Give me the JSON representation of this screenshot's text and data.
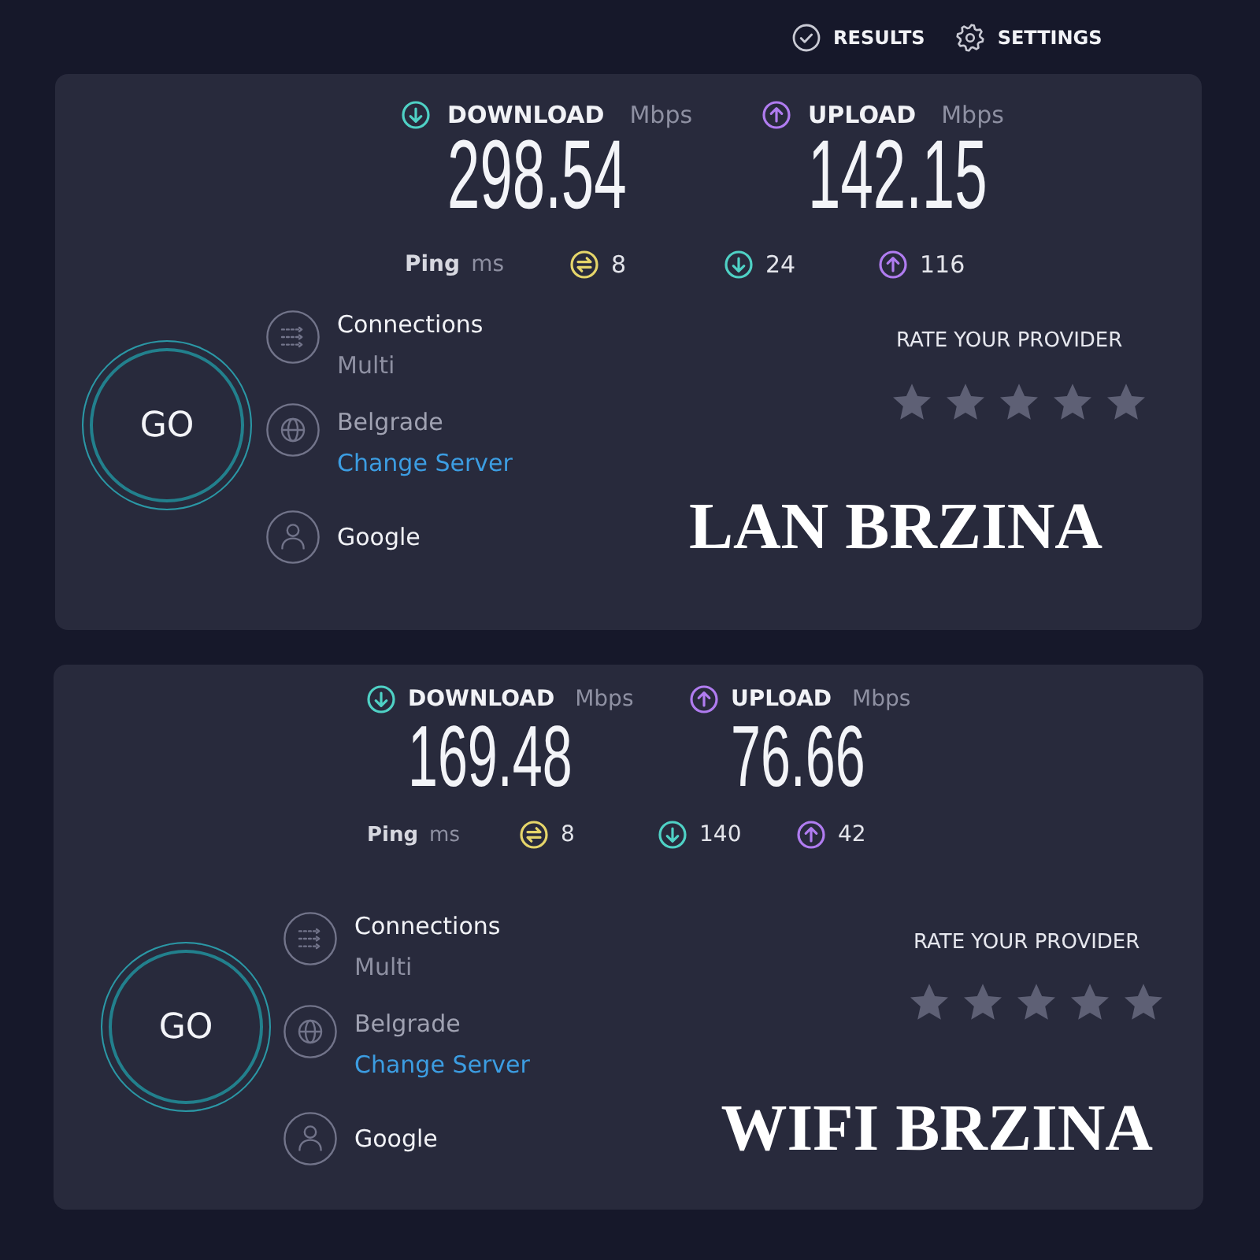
{
  "nav": [
    {
      "kind": "results",
      "label": "RESULTS"
    },
    {
      "kind": "settings",
      "label": "SETTINGS"
    }
  ],
  "panels": [
    {
      "speeds": [
        {
          "kind": "download",
          "label": "DOWNLOAD",
          "unit": "Mbps",
          "value": "298.54"
        },
        {
          "kind": "upload",
          "label": "UPLOAD",
          "unit": "Mbps",
          "value": "142.15"
        }
      ],
      "ping": {
        "label": "Ping",
        "unit": "ms",
        "readings": [
          {
            "kind": "idle",
            "value": "8"
          },
          {
            "kind": "download",
            "value": "24"
          },
          {
            "kind": "upload",
            "value": "116"
          }
        ]
      },
      "go_button": "GO",
      "details": [
        {
          "kind": "connections",
          "title": "Connections",
          "value": "Multi"
        },
        {
          "kind": "server",
          "title": "Belgrade",
          "link": "Change Server"
        },
        {
          "kind": "provider",
          "title": "Google"
        }
      ],
      "rating": {
        "title": "RATE YOUR PROVIDER",
        "stars": 0
      },
      "overlay_title": "LAN BRZINA"
    },
    {
      "speeds": [
        {
          "kind": "download",
          "label": "DOWNLOAD",
          "unit": "Mbps",
          "value": "169.48"
        },
        {
          "kind": "upload",
          "label": "UPLOAD",
          "unit": "Mbps",
          "value": "76.66"
        }
      ],
      "ping": {
        "label": "Ping",
        "unit": "ms",
        "readings": [
          {
            "kind": "idle",
            "value": "8"
          },
          {
            "kind": "download",
            "value": "140"
          },
          {
            "kind": "upload",
            "value": "42"
          }
        ]
      },
      "go_button": "GO",
      "details": [
        {
          "kind": "connections",
          "title": "Connections",
          "value": "Multi"
        },
        {
          "kind": "server",
          "title": "Belgrade",
          "link": "Change Server"
        },
        {
          "kind": "provider",
          "title": "Google"
        }
      ],
      "rating": {
        "title": "RATE YOUR PROVIDER",
        "stars": 0
      },
      "overlay_title": "WIFI BRZINA"
    }
  ]
}
